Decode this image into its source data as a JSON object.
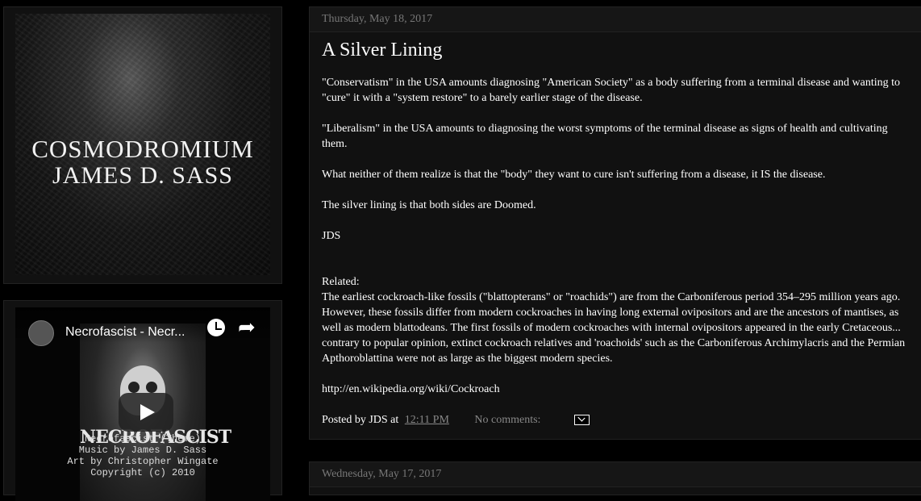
{
  "header": {
    "title": "COSMODROMIUM",
    "subtitle": "JAMES D. SASS"
  },
  "video": {
    "title": "Necrofascist - Necr...",
    "brand": "NECROFASCIST",
    "credits": [
      "Necrofascist (Theme)",
      "Music by James D. Sass",
      "Art by Christopher Wingate",
      "Copyright (c) 2010"
    ]
  },
  "posts": [
    {
      "date": "Thursday, May 18, 2017",
      "title": "A Silver Lining",
      "paragraphs": [
        "\"Conservatism\" in the USA amounts diagnosing \"American Society\" as a body suffering from a terminal disease and wanting to \"cure\" it with a \"system restore\" to a barely earlier stage of the disease.",
        "\"Liberalism\" in the USA amounts to diagnosing the worst symptoms of the terminal disease as signs of health and cultivating them.",
        "What neither of them realize is that the \"body\" they want to cure isn't suffering from a disease, it IS the disease.",
        "The silver lining is that both sides are Doomed.",
        "JDS",
        "Related:",
        "The earliest cockroach-like fossils (\"blattopterans\" or \"roachids\") are from the Carboniferous period 354–295 million years ago. However, these fossils differ from modern cockroaches in having long external ovipositors and are the ancestors of mantises, as well as modern blattodeans. The first fossils of modern cockroaches with internal ovipositors appeared in the early Cretaceous... contrary to popular opinion, extinct cockroach relatives and 'roachoids' such as the Carboniferous Archimylacris and the Permian Apthoroblattina were not as large as the biggest modern species.",
        "http://en.wikipedia.org/wiki/Cockroach"
      ],
      "footer": {
        "posted_by": "Posted by JDS at",
        "time": "12:11 PM",
        "comments": "No comments:"
      }
    },
    {
      "date": "Wednesday, May 17, 2017"
    }
  ]
}
